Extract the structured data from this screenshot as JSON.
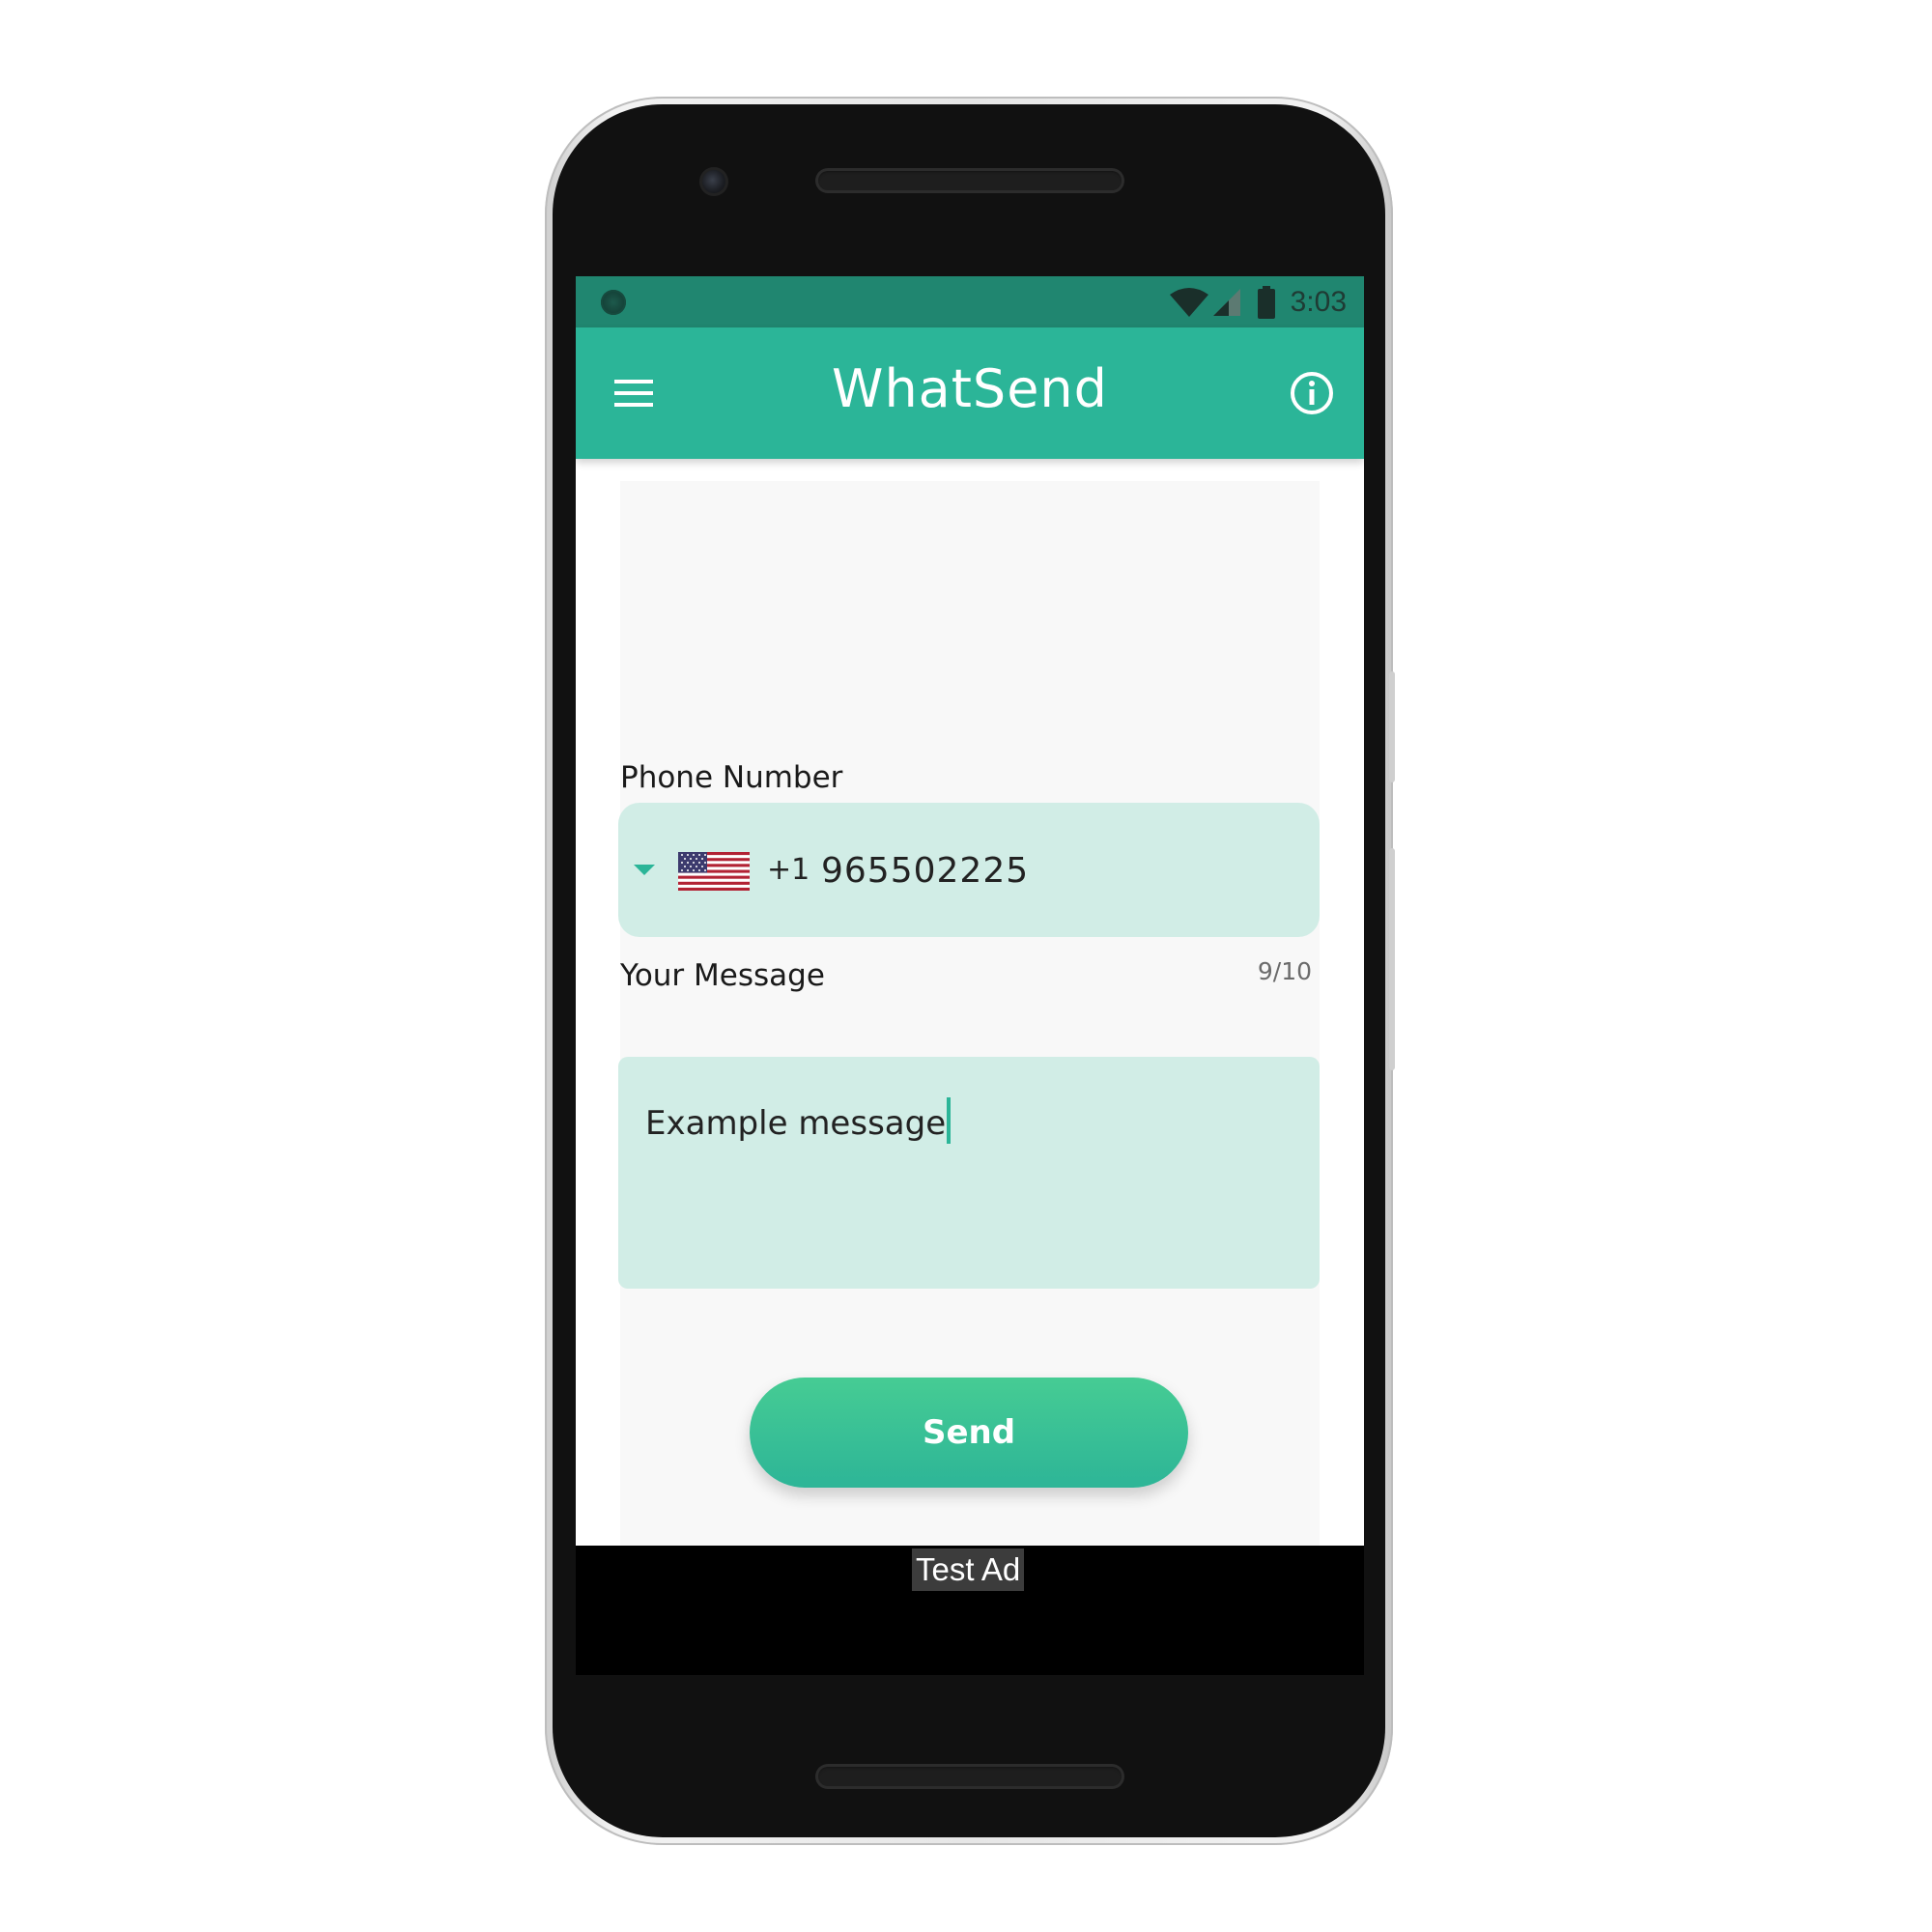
{
  "status_bar": {
    "time": "3:03"
  },
  "app_bar": {
    "title": "WhatSend",
    "menu_icon": "menu-icon",
    "info_icon": "info-icon"
  },
  "phone": {
    "label": "Phone Number",
    "country_flag": "us-flag-icon",
    "country_code": "+1",
    "value": "965502225",
    "counter": "9/10"
  },
  "message": {
    "label": "Your Message",
    "value": "Example message"
  },
  "send_label": "Send",
  "ad": {
    "label": "Test Ad"
  },
  "colors": {
    "status_bar": "#208670",
    "primary": "#2bb598",
    "field_bg": "#d1ede6"
  }
}
